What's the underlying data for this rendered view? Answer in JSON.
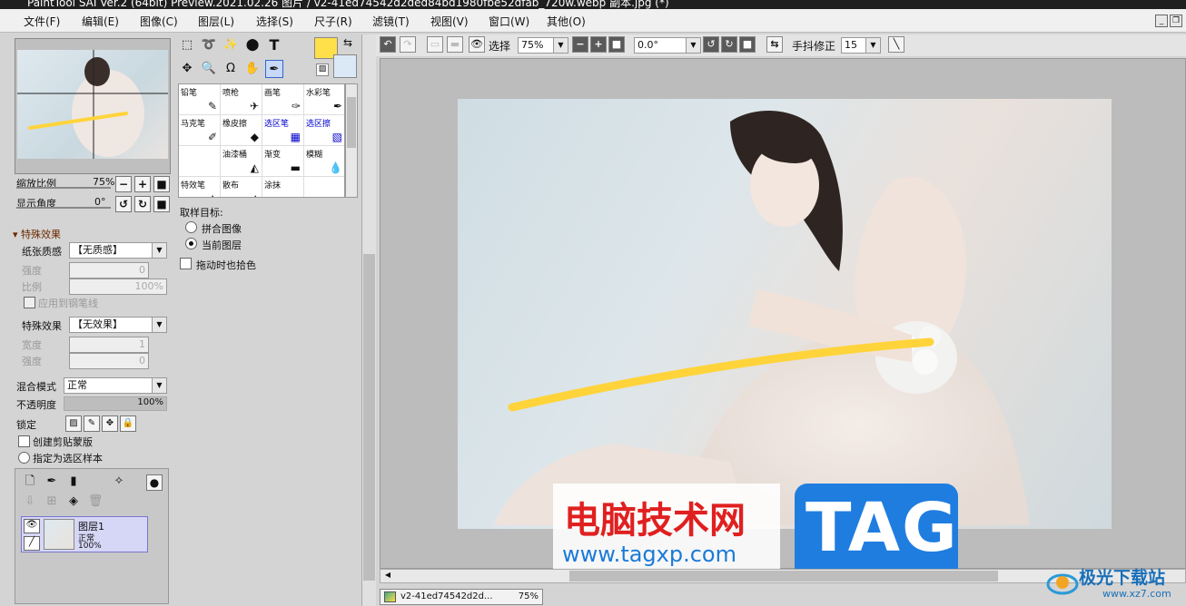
{
  "window": {
    "title": "PaintTool SAI Ver.2 (64bit) Preview.2021.02.26  图片 / v2-41ed74542d2ded84bd1980fbe52dfab_720w.webp  副本.jpg (*)"
  },
  "menu": [
    "文件(F)",
    "编辑(E)",
    "图像(C)",
    "图层(L)",
    "选择(S)",
    "尺子(R)",
    "滤镜(T)",
    "视图(V)",
    "窗口(W)",
    "其他(O)"
  ],
  "navigator": {
    "zoom_label": "缩放比例",
    "zoom_value": "75%",
    "angle_label": "显示角度",
    "angle_value": "0°"
  },
  "effects": {
    "header": "特殊效果",
    "paper_label": "纸张质感",
    "paper_value": "【无质感】",
    "strength_label": "强度",
    "strength_value": "0",
    "scale_label": "比例",
    "scale_value": "100%",
    "apply_pen_label": "应用到钢笔线",
    "effect_label": "特殊效果",
    "effect_value": "【无效果】",
    "width_label": "宽度",
    "width_value": "1",
    "strength2_label": "强度",
    "strength2_value": "0"
  },
  "layer_props": {
    "blend_label": "混合模式",
    "blend_value": "正常",
    "opacity_label": "不透明度",
    "opacity_value": "100%",
    "lock_label": "锁定",
    "clip_label": "创建剪贴蒙版",
    "sample_label": "指定为选区样本"
  },
  "layer": {
    "name": "图层1",
    "mode": "正常",
    "opacity": "100%"
  },
  "brushes": [
    {
      "name": "铅笔",
      "icon": "✎",
      "blue": false
    },
    {
      "name": "喷枪",
      "icon": "✈",
      "blue": false
    },
    {
      "name": "画笔",
      "icon": "✑",
      "blue": false
    },
    {
      "name": "水彩笔",
      "icon": "✒",
      "blue": false
    },
    {
      "name": "马克笔",
      "icon": "✐",
      "blue": false
    },
    {
      "name": "橡皮擦",
      "icon": "◆",
      "blue": false
    },
    {
      "name": "选区笔",
      "icon": "▦",
      "blue": true
    },
    {
      "name": "选区擦",
      "icon": "▧",
      "blue": true
    },
    {
      "name": "",
      "icon": "",
      "blue": false
    },
    {
      "name": "油漆桶",
      "icon": "◭",
      "blue": false
    },
    {
      "name": "渐变",
      "icon": "▬",
      "blue": false
    },
    {
      "name": "模糊",
      "icon": "💧",
      "blue": false
    },
    {
      "name": "特效笔",
      "icon": "✦",
      "blue": false
    },
    {
      "name": "散布",
      "icon": "∴",
      "blue": false
    },
    {
      "name": "涂抹",
      "icon": "☁",
      "blue": false
    },
    {
      "name": "",
      "icon": "",
      "blue": false
    }
  ],
  "sampling": {
    "label": "取样目标:",
    "opt1": "拼合图像",
    "opt2": "当前图层",
    "drag_label": "拖动时也拾色"
  },
  "colors": {
    "primary": "#ffe04a",
    "secondary": "#dbe9f7",
    "stroke": "#ffd43b"
  },
  "toolbar": {
    "select_label": "选择",
    "zoom_value": "75%",
    "angle_value": "0.0°",
    "stab_label": "手抖修正",
    "stab_value": "15"
  },
  "doc_tab": {
    "name": "v2-41ed74542d2d...",
    "zoom": "75%"
  },
  "watermark": {
    "cn_text": "电脑技术网",
    "url": "www.tagxp.com",
    "tag": "TAG",
    "site_name": "极光下载站",
    "site_url": "www.xz7.com"
  }
}
